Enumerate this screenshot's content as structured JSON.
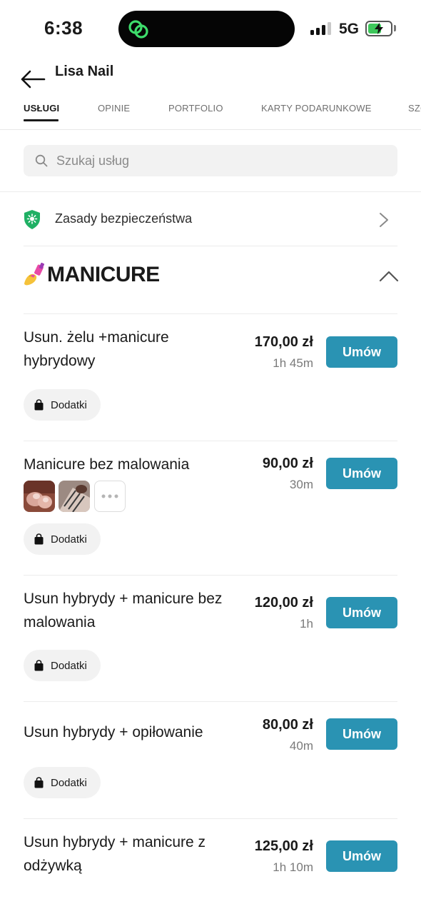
{
  "status_bar": {
    "time": "6:38",
    "network": "5G"
  },
  "header": {
    "title": "Lisa Nail"
  },
  "tabs": [
    {
      "label": "USŁUGI"
    },
    {
      "label": "OPINIE"
    },
    {
      "label": "PORTFOLIO"
    },
    {
      "label": "KARTY PODARUNKOWE"
    },
    {
      "label": "SZC"
    }
  ],
  "search": {
    "placeholder": "Szukaj usług"
  },
  "safety": {
    "label": "Zasady bezpieczeństwa"
  },
  "category": {
    "title": "MANICURE",
    "emoji_icon": "nail-polish-icon"
  },
  "services": [
    {
      "name": "Usun. żelu +manicure hybrydowy",
      "price": "170,00 zł",
      "duration": "1h 45m",
      "book_label": "Umów",
      "addons_label": "Dodatki"
    },
    {
      "name": "Manicure bez malowania",
      "price": "90,00 zł",
      "duration": "30m",
      "book_label": "Umów",
      "addons_label": "Dodatki"
    },
    {
      "name": "Usun hybrydy + manicure bez malowania",
      "price": "120,00 zł",
      "duration": "1h",
      "book_label": "Umów",
      "addons_label": "Dodatki"
    },
    {
      "name": "Usun hybrydy + opiłowanie",
      "price": "80,00 zł",
      "duration": "40m",
      "book_label": "Umów",
      "addons_label": "Dodatki"
    },
    {
      "name": "Usun hybrydy + manicure z odżywką",
      "price": "125,00 zł",
      "duration": "1h 10m",
      "book_label": "Umów"
    }
  ],
  "colors": {
    "accent": "#2a93b3",
    "shield": "#1fb064",
    "battery": "#3dc75b"
  }
}
